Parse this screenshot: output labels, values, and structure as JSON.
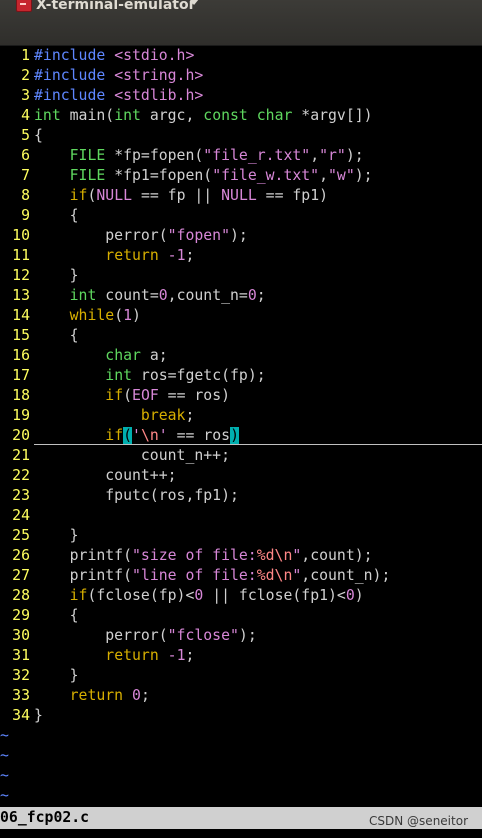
{
  "window": {
    "title": "X-terminal-emulator",
    "icon": "terminal-icon"
  },
  "statusbar": {
    "filename": "06_fcp02.c"
  },
  "watermark": "CSDN @seneitor",
  "empty_line_marker": "~",
  "colors": {
    "background": "#000000",
    "line_number": "#ffff5f",
    "preprocessor": "#5f87ff",
    "string": "#d787d7",
    "type": "#5fd75f",
    "keyword": "#d7af00",
    "format_specifier": "#ff8787",
    "match_paren": "#00afaf"
  },
  "lines": [
    {
      "n": "1",
      "tokens": [
        {
          "t": "#include ",
          "c": "pp"
        },
        {
          "t": "<stdio.h>",
          "c": "str"
        }
      ]
    },
    {
      "n": "2",
      "tokens": [
        {
          "t": "#include ",
          "c": "pp"
        },
        {
          "t": "<string.h>",
          "c": "str"
        }
      ]
    },
    {
      "n": "3",
      "tokens": [
        {
          "t": "#include ",
          "c": "pp"
        },
        {
          "t": "<stdlib.h>",
          "c": "str"
        }
      ]
    },
    {
      "n": "4",
      "tokens": [
        {
          "t": "int",
          "c": "type"
        },
        {
          "t": " main("
        },
        {
          "t": "int",
          "c": "type"
        },
        {
          "t": " argc, "
        },
        {
          "t": "const",
          "c": "type"
        },
        {
          "t": " "
        },
        {
          "t": "char",
          "c": "type"
        },
        {
          "t": " *argv[])"
        }
      ]
    },
    {
      "n": "5",
      "tokens": [
        {
          "t": "{"
        }
      ]
    },
    {
      "n": "6",
      "tokens": [
        {
          "t": "    "
        },
        {
          "t": "FILE",
          "c": "type"
        },
        {
          "t": " *fp=fopen("
        },
        {
          "t": "\"file_r.txt\"",
          "c": "str"
        },
        {
          "t": ","
        },
        {
          "t": "\"r\"",
          "c": "str"
        },
        {
          "t": ");"
        }
      ]
    },
    {
      "n": "7",
      "tokens": [
        {
          "t": "    "
        },
        {
          "t": "FILE",
          "c": "type"
        },
        {
          "t": " *fp1=fopen("
        },
        {
          "t": "\"file_w.txt\"",
          "c": "str"
        },
        {
          "t": ","
        },
        {
          "t": "\"w\"",
          "c": "str"
        },
        {
          "t": ");"
        }
      ]
    },
    {
      "n": "8",
      "tokens": [
        {
          "t": "    "
        },
        {
          "t": "if",
          "c": "kw"
        },
        {
          "t": "("
        },
        {
          "t": "NULL",
          "c": "str"
        },
        {
          "t": " == fp || "
        },
        {
          "t": "NULL",
          "c": "str"
        },
        {
          "t": " == fp1)"
        }
      ]
    },
    {
      "n": "9",
      "tokens": [
        {
          "t": "    {"
        }
      ]
    },
    {
      "n": "10",
      "tokens": [
        {
          "t": "        perror("
        },
        {
          "t": "\"fopen\"",
          "c": "str"
        },
        {
          "t": ");"
        }
      ]
    },
    {
      "n": "11",
      "tokens": [
        {
          "t": "        "
        },
        {
          "t": "return",
          "c": "kw"
        },
        {
          "t": " "
        },
        {
          "t": "-1",
          "c": "num"
        },
        {
          "t": ";"
        }
      ]
    },
    {
      "n": "12",
      "tokens": [
        {
          "t": "    }"
        }
      ]
    },
    {
      "n": "13",
      "tokens": [
        {
          "t": "    "
        },
        {
          "t": "int",
          "c": "type"
        },
        {
          "t": " count="
        },
        {
          "t": "0",
          "c": "num"
        },
        {
          "t": ",count_n="
        },
        {
          "t": "0",
          "c": "num"
        },
        {
          "t": ";"
        }
      ]
    },
    {
      "n": "14",
      "tokens": [
        {
          "t": "    "
        },
        {
          "t": "while",
          "c": "kw"
        },
        {
          "t": "("
        },
        {
          "t": "1",
          "c": "num"
        },
        {
          "t": ")"
        }
      ]
    },
    {
      "n": "15",
      "tokens": [
        {
          "t": "    {"
        }
      ]
    },
    {
      "n": "16",
      "tokens": [
        {
          "t": "        "
        },
        {
          "t": "char",
          "c": "type"
        },
        {
          "t": " a;"
        }
      ]
    },
    {
      "n": "17",
      "tokens": [
        {
          "t": "        "
        },
        {
          "t": "int",
          "c": "type"
        },
        {
          "t": " ros=fgetc(fp);"
        }
      ]
    },
    {
      "n": "18",
      "tokens": [
        {
          "t": "        "
        },
        {
          "t": "if",
          "c": "kw"
        },
        {
          "t": "("
        },
        {
          "t": "EOF",
          "c": "str"
        },
        {
          "t": " == ros)"
        }
      ]
    },
    {
      "n": "19",
      "tokens": [
        {
          "t": "            "
        },
        {
          "t": "break",
          "c": "kw"
        },
        {
          "t": ";"
        }
      ]
    },
    {
      "n": "20",
      "cursor": true,
      "tokens": [
        {
          "t": "        "
        },
        {
          "t": "if",
          "c": "kw"
        },
        {
          "t": "(",
          "c": "match"
        },
        {
          "t": "'",
          "c": "str"
        },
        {
          "t": "\\n",
          "c": "fmt"
        },
        {
          "t": "'",
          "c": "str"
        },
        {
          "t": " == ros"
        },
        {
          "t": ")",
          "c": "match"
        }
      ]
    },
    {
      "n": "21",
      "tokens": [
        {
          "t": "            count_n++;"
        }
      ]
    },
    {
      "n": "22",
      "tokens": [
        {
          "t": "        count++;"
        }
      ]
    },
    {
      "n": "23",
      "tokens": [
        {
          "t": "        fputc(ros,fp1);"
        }
      ]
    },
    {
      "n": "24",
      "tokens": []
    },
    {
      "n": "25",
      "tokens": [
        {
          "t": "    }"
        }
      ]
    },
    {
      "n": "26",
      "tokens": [
        {
          "t": "    printf("
        },
        {
          "t": "\"size of file:",
          "c": "str"
        },
        {
          "t": "%d\\n",
          "c": "fmt"
        },
        {
          "t": "\"",
          "c": "str"
        },
        {
          "t": ",count);"
        }
      ]
    },
    {
      "n": "27",
      "tokens": [
        {
          "t": "    printf("
        },
        {
          "t": "\"line of file:",
          "c": "str"
        },
        {
          "t": "%d\\n",
          "c": "fmt"
        },
        {
          "t": "\"",
          "c": "str"
        },
        {
          "t": ",count_n);"
        }
      ]
    },
    {
      "n": "28",
      "tokens": [
        {
          "t": "    "
        },
        {
          "t": "if",
          "c": "kw"
        },
        {
          "t": "(fclose(fp)<"
        },
        {
          "t": "0",
          "c": "num"
        },
        {
          "t": " || fclose(fp1)<"
        },
        {
          "t": "0",
          "c": "num"
        },
        {
          "t": ")"
        }
      ]
    },
    {
      "n": "29",
      "tokens": [
        {
          "t": "    {"
        }
      ]
    },
    {
      "n": "30",
      "tokens": [
        {
          "t": "        perror("
        },
        {
          "t": "\"fclose\"",
          "c": "str"
        },
        {
          "t": ");"
        }
      ]
    },
    {
      "n": "31",
      "tokens": [
        {
          "t": "        "
        },
        {
          "t": "return",
          "c": "kw"
        },
        {
          "t": " "
        },
        {
          "t": "-1",
          "c": "num"
        },
        {
          "t": ";"
        }
      ]
    },
    {
      "n": "32",
      "tokens": [
        {
          "t": "    }"
        }
      ]
    },
    {
      "n": "33",
      "tokens": [
        {
          "t": "    "
        },
        {
          "t": "return",
          "c": "kw"
        },
        {
          "t": " "
        },
        {
          "t": "0",
          "c": "num"
        },
        {
          "t": ";"
        }
      ]
    },
    {
      "n": "34",
      "tokens": [
        {
          "t": "}"
        }
      ]
    }
  ]
}
